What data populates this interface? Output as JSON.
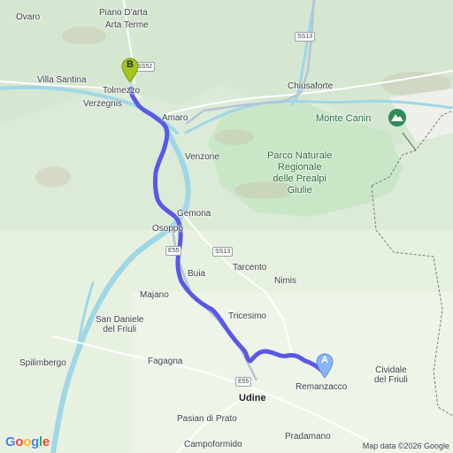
{
  "map": {
    "places": {
      "ovaro": "Ovaro",
      "piano_darta": "Piano D'arta",
      "arta_terme": "Arta Terme",
      "villa_santina": "Villa Santina",
      "tolmezzo": "Tolmezzo",
      "verzegnis": "Verzegnis",
      "amaro": "Amaro",
      "chiusaforte": "Chiusaforte",
      "venzone": "Venzone",
      "gemona": "Gemona",
      "osoppo": "Osoppo",
      "buia": "Buia",
      "tarcento": "Tarcento",
      "nimis": "Nimis",
      "majano": "Majano",
      "tricesimo": "Tricesimo",
      "san_daniele": "San Daniele\ndel Friuli",
      "spilimbergo": "Spilimbergo",
      "fagagna": "Fagagna",
      "remanzacco": "Remanzacco",
      "cividale": "Cividale\ndel Friuli",
      "udine": "Udine",
      "pasian": "Pasian di Prato",
      "pradamano": "Pradamano",
      "campoformido": "Campoformido"
    },
    "park_label": "Parco Naturale\nRegionale\ndelle Prealpi\nGiulie",
    "peak_label": "Monte Canin",
    "road_shields": {
      "ss52": "SS52",
      "ss13_top": "SS13",
      "ss13_mid": "SS13",
      "e55_mid": "E55",
      "e55_south": "E55"
    },
    "markers": {
      "a": "A",
      "b": "B"
    },
    "logo": "Google",
    "attribution": "Map data ©2026 Google",
    "colors": {
      "route": "#5a58e8",
      "marker_a": "#8ab4f8",
      "marker_b": "#a8c41e",
      "river": "#9fd7e6",
      "park": "#c6e5c4",
      "background": "#dfeedd"
    }
  }
}
